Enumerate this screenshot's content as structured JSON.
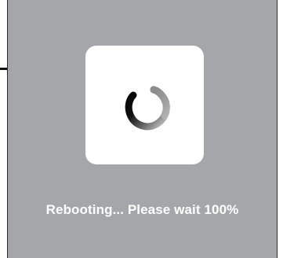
{
  "dialog": {
    "status_text": "Rebooting... Please wait",
    "progress_percent": 100,
    "progress_label": "100%"
  },
  "colors": {
    "overlay": "#a5a6aa",
    "modal": "#ffffff",
    "text": "#ffffff",
    "spinner": "#111111"
  },
  "icons": {
    "spinner": "loading-spinner-icon"
  }
}
